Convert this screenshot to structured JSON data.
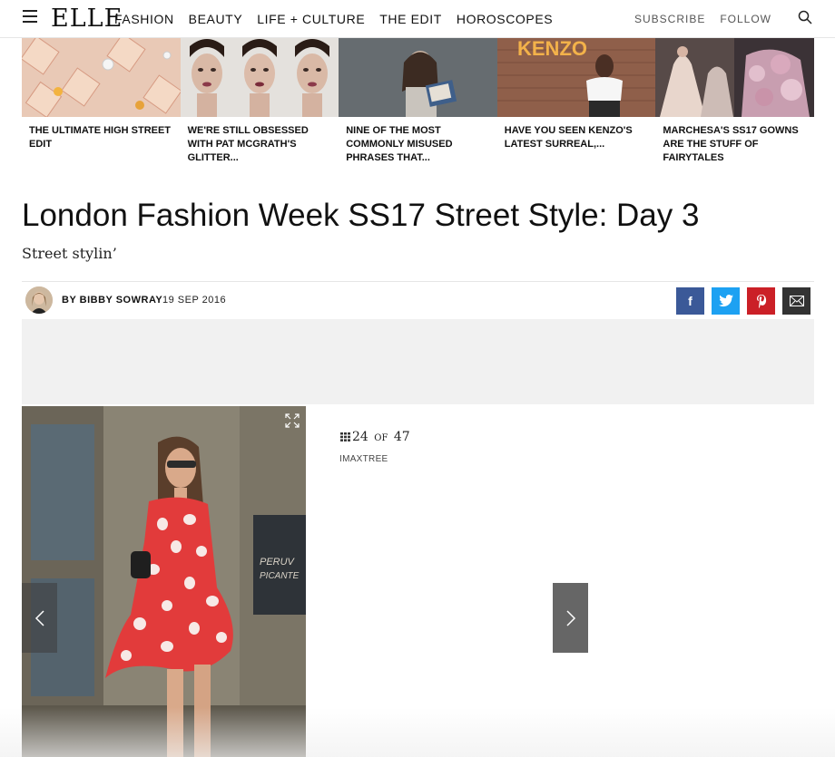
{
  "header": {
    "logo": "ELLE",
    "nav": [
      "FASHION",
      "BEAUTY",
      "LIFE + CULTURE",
      "THE EDIT",
      "HOROSCOPES"
    ],
    "subscribe": "SUBSCRIBE",
    "follow": "FOLLOW",
    "icons": {
      "menu": "hamburger-icon",
      "search": "search-icon"
    }
  },
  "related": [
    {
      "title": "THE ULTIMATE HIGH STREET EDIT"
    },
    {
      "title": "WE'RE STILL OBSESSED WITH PAT MCGRATH'S GLITTER..."
    },
    {
      "title": "NINE OF THE MOST COMMONLY MISUSED PHRASES THAT..."
    },
    {
      "title": "HAVE YOU SEEN KENZO'S LATEST SURREAL,..."
    },
    {
      "title": "MARCHESA'S SS17 GOWNS ARE THE STUFF OF FAIRYTALES"
    }
  ],
  "related_sign": "KENZO",
  "article": {
    "headline": "London Fashion Week SS17 Street Style: Day 3",
    "subheadline": "Street stylin’",
    "byline": "BY BIBBY SOWRAY",
    "date": "19 SEP 2016"
  },
  "share": {
    "facebook": "f",
    "colors": {
      "facebook": "#3b5998",
      "twitter": "#1da1f2",
      "pinterest": "#cb2027",
      "email": "#333333"
    }
  },
  "gallery": {
    "current": "24",
    "of": "OF",
    "total": "47",
    "credit": "IMAXTREE",
    "sign_text": "PERUV\nPICANTE"
  }
}
